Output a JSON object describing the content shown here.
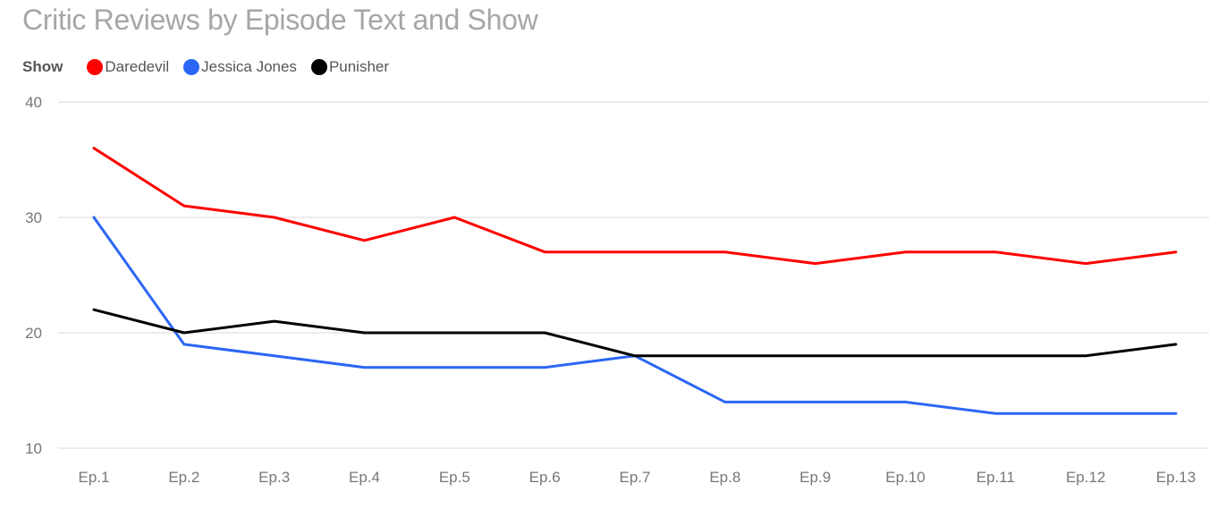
{
  "chart_data": {
    "type": "line",
    "title": "Critic Reviews by Episode Text and Show",
    "xlabel": "",
    "ylabel": "",
    "legend_title": "Show",
    "legend_position": "top-left",
    "grid": true,
    "ylim": [
      10,
      40
    ],
    "yticks": [
      10,
      20,
      30,
      40
    ],
    "categories": [
      "Ep.1",
      "Ep.2",
      "Ep.3",
      "Ep.4",
      "Ep.5",
      "Ep.6",
      "Ep.7",
      "Ep.8",
      "Ep.9",
      "Ep.10",
      "Ep.11",
      "Ep.12",
      "Ep.13"
    ],
    "series": [
      {
        "name": "Daredevil",
        "color": "#ff0000",
        "values": [
          36,
          31,
          30,
          28,
          30,
          27,
          27,
          27,
          26,
          27,
          27,
          26,
          27
        ]
      },
      {
        "name": "Jessica Jones",
        "color": "#2b66f5",
        "values": [
          30,
          19,
          18,
          17,
          17,
          17,
          18,
          14,
          14,
          14,
          13,
          13,
          13
        ]
      },
      {
        "name": "Punisher",
        "color": "#000000",
        "values": [
          22,
          20,
          21,
          20,
          20,
          20,
          18,
          18,
          18,
          18,
          18,
          18,
          19
        ]
      }
    ]
  }
}
